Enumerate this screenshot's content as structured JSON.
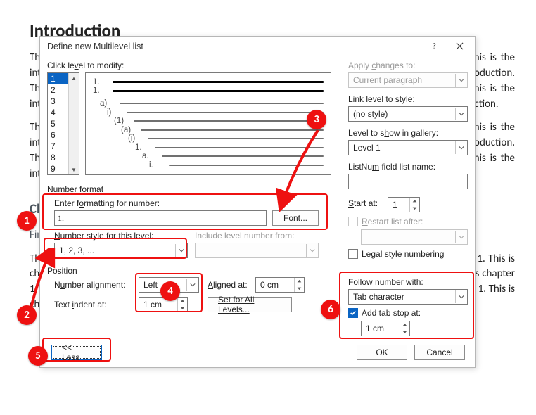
{
  "doc": {
    "heading": "Introduction",
    "intro_para": "This is the introduction. This is the introduction. This is the introduction. This is the introduction. This is the introduction. This is the introduction. This is the introduction. This is the introduction. This is the introduction. This is the introduction. This is the introduction. This is the introduction. This is the introduction. This is the introduction. This is the introduction. This is the introduction. This is the introduction. This is the introduction.",
    "middle_para": "This is the introduction. This is the introduction. This is the introduction. This is the introduction. This is the introduction. This is the introduction. This is the introduction. This is the introduction. This is the introduction. This is the introduction. This is the introduction. This is the introduction. This is the introduction. This is the introduction. This is the introduction.",
    "ch_heading": "Chapter",
    "first": "First",
    "chapter_para": "This is chapter 1. This is chapter 1. This is chapter 1. This is chapter 1. This is chapter 1. This is chapter 1. This is chapter 1. This is chapter 1. This is chapter 1. This is chapter 1. This is chapter 1. This is chapter 1. This is chapter 1. This is chapter 1. This is chapter 1. This is chapter 1. This is chapter 1. This is chapter 1. This is chapter 1. This is chapter 1. This is chapter 1. This is chapter 1. This is chapter"
  },
  "dialog": {
    "title": "Define new Multilevel list",
    "click_level_label": "Click level to modify:",
    "levels": [
      "1",
      "2",
      "3",
      "4",
      "5",
      "6",
      "7",
      "8",
      "9"
    ],
    "selected_level": "1",
    "preview_numbers": [
      "1.",
      "1.",
      "a)",
      "i)",
      "(1)",
      "(a)",
      "(i)",
      "1.",
      "a.",
      "i."
    ],
    "number_format_section": "Number format",
    "enter_formatting_label": "Enter formatting for number:",
    "formatting_value": "1.",
    "font_btn": "Font...",
    "number_style_label": "Number style for this level:",
    "number_style_value": "1, 2, 3, ...",
    "include_level_label": "Include level number from:",
    "include_level_value": "",
    "apply_changes_label": "Apply changes to:",
    "apply_changes_value": "Current paragraph",
    "link_level_label": "Link level to style:",
    "link_level_value": "(no style)",
    "level_show_label": "Level to show in gallery:",
    "level_show_value": "Level 1",
    "listnum_label": "ListNum field list name:",
    "listnum_value": "",
    "start_at_label": "Start at:",
    "start_at_value": "1",
    "restart_label": "Restart list after:",
    "restart_value": "",
    "legal_label": "Legal style numbering",
    "position_section": "Position",
    "number_alignment_label": "Number alignment:",
    "number_alignment_value": "Left",
    "aligned_at_label": "Aligned at:",
    "aligned_at_value": "0 cm",
    "text_indent_label": "Text indent at:",
    "text_indent_value": "1 cm",
    "set_all_levels": "Set for All Levels...",
    "follow_number_label": "Follow number with:",
    "follow_number_value": "Tab character",
    "add_tab_label": "Add tab stop at:",
    "add_tab_value": "1 cm",
    "less_btn": "<< Less",
    "ok_btn": "OK",
    "cancel_btn": "Cancel"
  }
}
